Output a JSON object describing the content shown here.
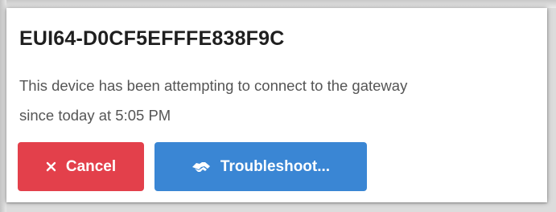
{
  "dialog": {
    "title": "EUI64-D0CF5EFFFE838F9C",
    "message_line1": "This device has been attempting to connect to the gateway",
    "message_line2": "since today at 5:05 PM"
  },
  "buttons": {
    "cancel_label": "Cancel",
    "cancel_icon": "close-icon",
    "troubleshoot_label": "Troubleshoot...",
    "troubleshoot_icon": "handshake-icon"
  },
  "colors": {
    "cancel_bg": "#e3404b",
    "troubleshoot_bg": "#3a86d4"
  }
}
